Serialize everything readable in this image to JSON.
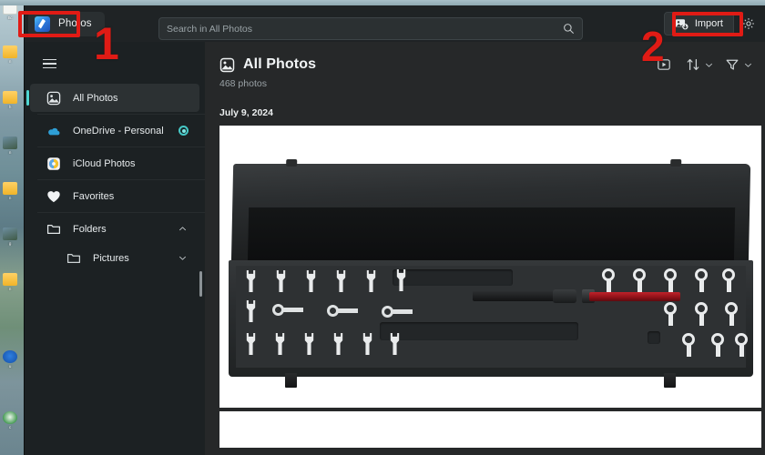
{
  "app": {
    "name": "Photos",
    "icon": "photos-app-icon"
  },
  "search": {
    "placeholder": "Search in All Photos",
    "value": "",
    "icon": "search-icon"
  },
  "titlebar": {
    "import_label": "Import",
    "import_icon": "import-photos-icon",
    "settings_icon": "gear-icon"
  },
  "sidebar": {
    "menu_icon": "hamburger-menu-icon",
    "scrollbar": "vertical-scrollbar",
    "items": [
      {
        "label": "All Photos",
        "icon": "all-photos-icon",
        "active": true
      },
      {
        "label": "OneDrive - Personal",
        "icon": "onedrive-icon",
        "badge": "sync-status-badge"
      },
      {
        "label": "iCloud Photos",
        "icon": "icloud-photos-icon"
      },
      {
        "label": "Favorites",
        "icon": "heart-icon"
      },
      {
        "label": "Folders",
        "icon": "folder-icon",
        "chevron": "chevron-up-icon"
      },
      {
        "label": "Pictures",
        "icon": "folder-icon",
        "chevron": "chevron-down-icon",
        "sub": true
      }
    ]
  },
  "content": {
    "title": "All Photos",
    "title_icon": "all-photos-icon",
    "count": "468 photos",
    "date_group": "July 9, 2024",
    "tools": [
      {
        "name": "slideshow-button",
        "icon": "play-box-icon"
      },
      {
        "name": "sort-button",
        "icon": "sort-arrows-icon",
        "chevron": "chevron-down-icon"
      },
      {
        "name": "filter-button",
        "icon": "funnel-icon",
        "chevron": "chevron-down-icon"
      }
    ],
    "photos": [
      {
        "name": "photo-tool-case",
        "alt": "Black tool case with wrench set and red torque wrench"
      },
      {
        "name": "photo-next",
        "alt": "Next photo partially visible"
      }
    ]
  },
  "annotations": [
    {
      "label": "1",
      "target": "photos-app-title",
      "color": "#e01b15"
    },
    {
      "label": "2",
      "target": "import-button",
      "color": "#e01b15"
    }
  ],
  "desktop": {
    "icons": [
      {
        "label": "Bc",
        "type": "doc"
      },
      {
        "label": "n",
        "type": "folder"
      },
      {
        "label": "h",
        "type": "folder"
      },
      {
        "label": "n",
        "type": "photo"
      },
      {
        "label": "n",
        "type": "folder"
      },
      {
        "label": "g",
        "type": "photo"
      },
      {
        "label": "n",
        "type": "folder"
      },
      {
        "label": "u",
        "type": "blue"
      },
      {
        "label": "c",
        "type": "green"
      }
    ]
  },
  "colors": {
    "accent": "#4fd6d2",
    "annotation": "#e01b15",
    "sidebar_bg": "#1c2123",
    "content_bg": "#262829",
    "titlebar_bg": "#1f2325"
  }
}
